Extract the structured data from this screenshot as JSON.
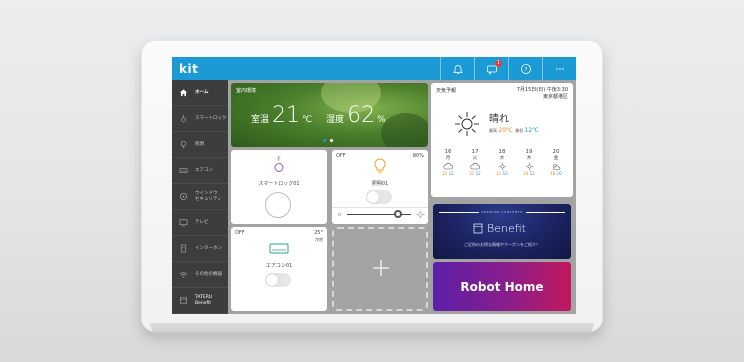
{
  "app": {
    "logo": "kit"
  },
  "topbar": {
    "icons": [
      "bell-icon",
      "message-icon",
      "help-icon",
      "more-icon"
    ],
    "message_badge": "1",
    "more_label": "···",
    "help_label": "?"
  },
  "sidebar": {
    "items": [
      {
        "label": "ホーム",
        "icon": "home-icon",
        "active": true
      },
      {
        "label": "スマートロック",
        "icon": "lock-icon",
        "active": false
      },
      {
        "label": "照明",
        "icon": "bulb-icon",
        "active": false
      },
      {
        "label": "エアコン",
        "icon": "aircon-icon",
        "active": false
      },
      {
        "label": "ウインドウ\nセキュリティ",
        "icon": "window-security-icon",
        "active": false
      },
      {
        "label": "テレビ",
        "icon": "tv-icon",
        "active": false
      },
      {
        "label": "インターホン",
        "icon": "intercom-icon",
        "active": false
      },
      {
        "label": "その他の機器",
        "icon": "wifi-icon",
        "active": false
      },
      {
        "label": "TATERU\nBenefit",
        "icon": "benefit-icon",
        "active": false
      }
    ]
  },
  "environment": {
    "title": "室内環境",
    "temp_label": "室温",
    "temp_value": "21",
    "temp_unit": "℃",
    "humidity_label": "湿度",
    "humidity_value": "62",
    "humidity_unit": "%"
  },
  "weather": {
    "title": "天気予報",
    "date": "7月15日(日) 午後3:30",
    "location": "東京都港区",
    "condition": "晴れ",
    "high_label": "最高",
    "high": "20",
    "high_unit": "℃",
    "low_label": "最低",
    "low": "12",
    "low_unit": "℃",
    "forecast": [
      {
        "day": "16",
        "dow": "月",
        "icon": "cloud-icon",
        "high": "21",
        "low": "12"
      },
      {
        "day": "17",
        "dow": "火",
        "icon": "cloud-icon",
        "high": "21",
        "low": "12"
      },
      {
        "day": "18",
        "dow": "水",
        "icon": "sun-icon",
        "high": "21",
        "low": "10"
      },
      {
        "day": "19",
        "dow": "木",
        "icon": "sun-icon",
        "high": "24",
        "low": "12"
      },
      {
        "day": "20",
        "dow": "金",
        "icon": "sun-cloud-icon",
        "high": "18",
        "low": "10"
      }
    ]
  },
  "devices": {
    "lock": {
      "label": "スマートロック01",
      "icon_letter": "F"
    },
    "light": {
      "status": "OFF",
      "level": "80%",
      "label": "照明01"
    },
    "aircon": {
      "status": "OFF",
      "temp": "25°",
      "mode": "冷房",
      "label": "エアコン01"
    },
    "add_symbol": "+"
  },
  "benefit": {
    "header": "PREMIUM CONTENTS",
    "title": "Benefit",
    "subtitle": "ご近所のお得な情報やクーポンをご紹介！"
  },
  "robot_home": {
    "label": "Robot Home"
  },
  "colors": {
    "accent": "#1c9ad6",
    "sidebar": "#3d3d40",
    "high": "#e08a2c",
    "low": "#2c8fd6"
  }
}
